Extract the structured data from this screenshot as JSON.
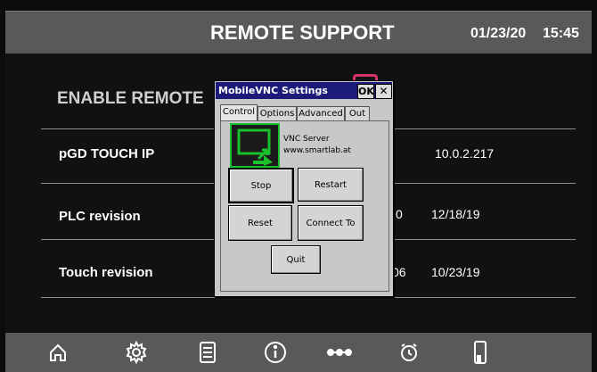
{
  "header": {
    "title": "REMOTE SUPPORT",
    "date": "01/23/20",
    "time": "15:45"
  },
  "main": {
    "enable_label": "ENABLE REMOTE",
    "rows": [
      {
        "label": "pGD TOUCH IP",
        "partial": "",
        "value": "10.0.2.217"
      },
      {
        "label": "PLC revision",
        "partial": "0",
        "value": "12/18/19"
      },
      {
        "label": "Touch revision",
        "partial": "06",
        "value": "10/23/19"
      }
    ]
  },
  "dialog": {
    "title": "MobileVNC Settings",
    "ok_label": "OK",
    "close_label": "✕",
    "tabs": [
      "Control",
      "Options",
      "Advanced",
      "Out"
    ],
    "server_name": "VNC Server",
    "server_url": "www.smartlab.at",
    "buttons": {
      "stop": "Stop",
      "restart": "Restart",
      "reset": "Reset",
      "connect_to": "Connect To",
      "quit": "Quit"
    }
  },
  "nav": {
    "icons": [
      "home-icon",
      "gear-icon",
      "document-icon",
      "info-icon",
      "more-icon",
      "alarm-clock-icon",
      "device-icon"
    ]
  },
  "colors": {
    "header_bg": "#595959",
    "dialog_titlebar": "#1c1b7a",
    "vnc_accent": "#19c12c",
    "toggle_accent": "#d8336b"
  }
}
